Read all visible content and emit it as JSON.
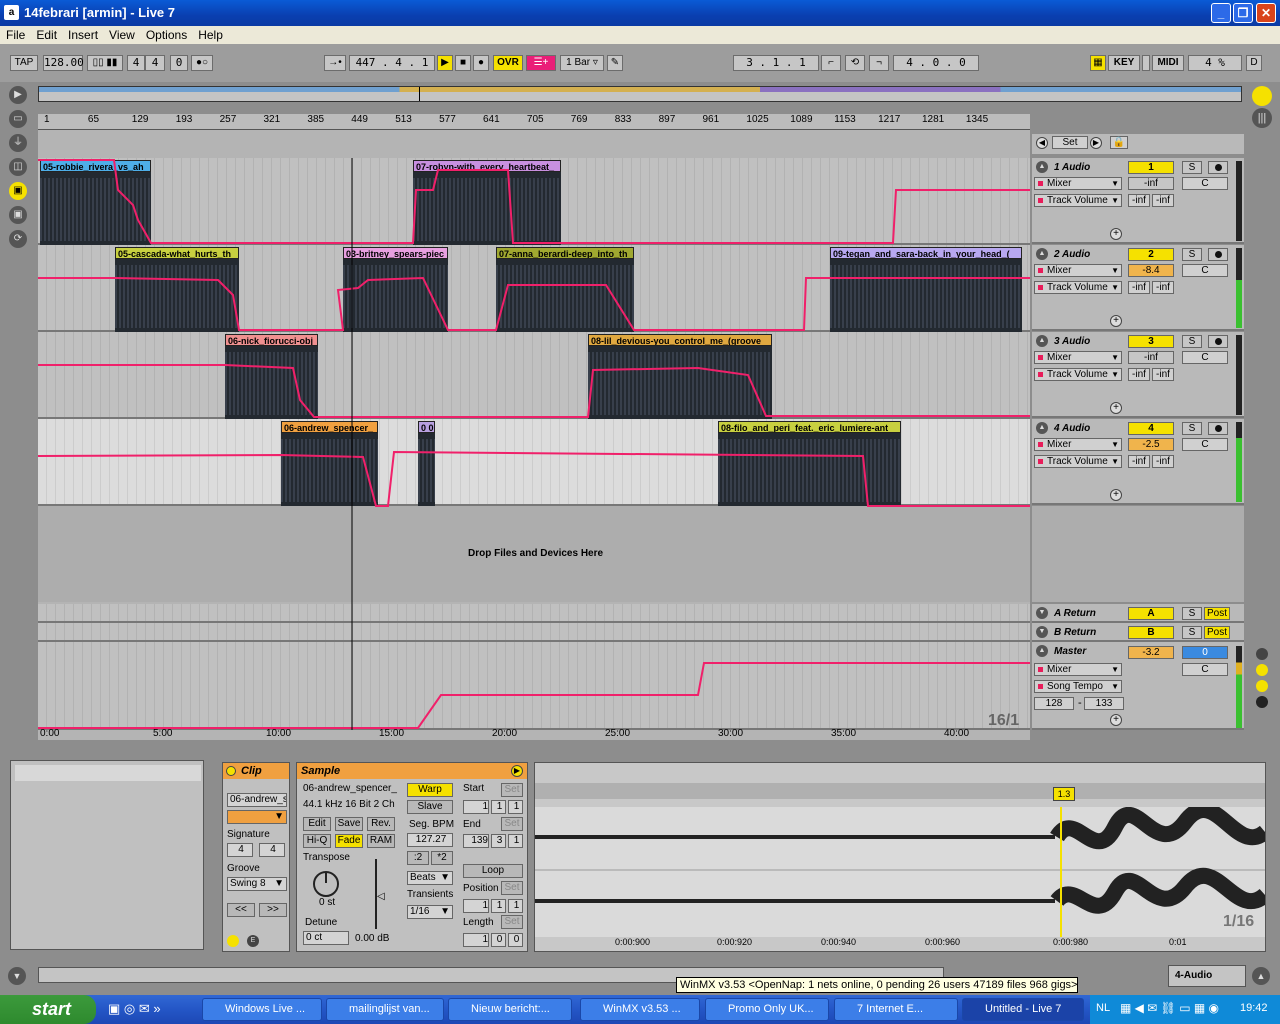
{
  "window": {
    "title": "14febrari  [armin] - Live 7"
  },
  "menu": [
    "File",
    "Edit",
    "Insert",
    "View",
    "Options",
    "Help"
  ],
  "transport": {
    "tap": "TAP",
    "tempo": "128.00",
    "signature_num": "4",
    "signature_den": "4",
    "metronome": "0",
    "position": "447 .  4 .  1",
    "ovr": "OVR",
    "quantize": "1 Bar",
    "loop_start": "3 .  1 .  1",
    "loop_length": "4 .  0 .  0",
    "key": "KEY",
    "midi": "MIDI",
    "cpu": "4 %",
    "d": "D"
  },
  "ruler": [
    "1",
    "65",
    "129",
    "193",
    "257",
    "321",
    "385",
    "449",
    "513",
    "577",
    "641",
    "705",
    "769",
    "833",
    "897",
    "961",
    "1025",
    "1089",
    "1153",
    "1217",
    "1281",
    "1345"
  ],
  "time_ruler": [
    "0:00",
    "5:00",
    "10:00",
    "15:00",
    "20:00",
    "25:00",
    "30:00",
    "35:00",
    "40:00"
  ],
  "zoom_label": "16/1",
  "set_label": "Set",
  "drop_label": "Drop Files and Devices Here",
  "tracks": [
    {
      "name": "1 Audio",
      "num": "1",
      "device": "Mixer",
      "param": "Track Volume",
      "vol": "-inf",
      "pan": "C",
      "sendA": "-inf",
      "sendB": "-inf",
      "clips": [
        "05-robbie_rivera_vs_ah",
        "07-robyn-with_every_heartbeat_"
      ]
    },
    {
      "name": "2 Audio",
      "num": "2",
      "device": "Mixer",
      "param": "Track Volume",
      "vol": "-8.4",
      "pan": "C",
      "sendA": "-inf",
      "sendB": "-inf",
      "clips": [
        "05-cascada-what_hurts_th",
        "03-britney_spears-piec",
        "07-anna_berardi-deep_into_th",
        "09-tegan_and_sara-back_in_your_head_("
      ]
    },
    {
      "name": "3 Audio",
      "num": "3",
      "device": "Mixer",
      "param": "Track Volume",
      "vol": "-inf",
      "pan": "C",
      "sendA": "-inf",
      "sendB": "-inf",
      "clips": [
        "06-nick_fiorucci-obj",
        "08-lil_devious-you_control_me_(groove"
      ]
    },
    {
      "name": "4 Audio",
      "num": "4",
      "device": "Mixer",
      "param": "Track Volume",
      "vol": "-2.5",
      "pan": "C",
      "sendA": "-inf",
      "sendB": "-inf",
      "clips": [
        "06-andrew_spencer_",
        "0 0",
        "08-filo_and_peri_feat._eric_lumiere-ant"
      ]
    }
  ],
  "returns": [
    {
      "name": "A Return",
      "num": "A",
      "s": "S",
      "post": "Post"
    },
    {
      "name": "B Return",
      "num": "B",
      "s": "S",
      "post": "Post"
    }
  ],
  "master": {
    "name": "Master",
    "vol": "-3.2",
    "cue": "0",
    "pan": "C",
    "device": "Mixer",
    "param": "Song Tempo",
    "min": "128",
    "max": "133"
  },
  "clip_panel": {
    "title": "Clip",
    "name": "06-andrew_s",
    "signature_label": "Signature",
    "sig_num": "4",
    "sig_den": "4",
    "groove_label": "Groove",
    "groove": "Swing 8"
  },
  "sample_panel": {
    "title": "Sample",
    "file": "06-andrew_spencer_",
    "info": "44.1 kHz 16 Bit 2 Ch",
    "edit": "Edit",
    "save": "Save",
    "rev": "Rev.",
    "hiq": "Hi-Q",
    "fade": "Fade",
    "ram": "RAM",
    "transpose_label": "Transpose",
    "transpose": "0 st",
    "detune_label": "Detune",
    "detune": "0 ct",
    "gain": "0.00 dB",
    "warp": "Warp",
    "slave": "Slave",
    "segbpm_label": "Seg. BPM",
    "segbpm": "127.27",
    "half": ":2",
    "double": "*2",
    "mode": "Beats",
    "transients_label": "Transients",
    "transients": "1/16",
    "start_label": "Start",
    "start": [
      "1",
      "1",
      "1"
    ],
    "end_label": "End",
    "end": [
      "139",
      "3",
      "1"
    ],
    "loop": "Loop",
    "position_label": "Position",
    "position": [
      "1",
      "1",
      "1"
    ],
    "length_label": "Length",
    "length": [
      "1",
      "0",
      "0"
    ],
    "set": "Set"
  },
  "waveform": {
    "marker": "1.3",
    "times": [
      "0:00:900",
      "0:00:920",
      "0:00:940",
      "0:00:960",
      "0:00:980",
      "0:01"
    ],
    "zoom": "1/16"
  },
  "status": {
    "track_label": "4-Audio"
  },
  "tooltip": "WinMX v3.53  <OpenNap: 1 nets online, 0 pending  26 users 47189 files 968 gigs>",
  "taskbar": {
    "start": "start",
    "items": [
      "Windows Live ...",
      "mailinglijst van...",
      "Nieuw bericht:...",
      "WinMX v3.53 ...",
      "Promo Only UK...",
      "7 Internet E...",
      "Untitled - Live 7"
    ],
    "lang": "NL",
    "clock": "19:42"
  }
}
